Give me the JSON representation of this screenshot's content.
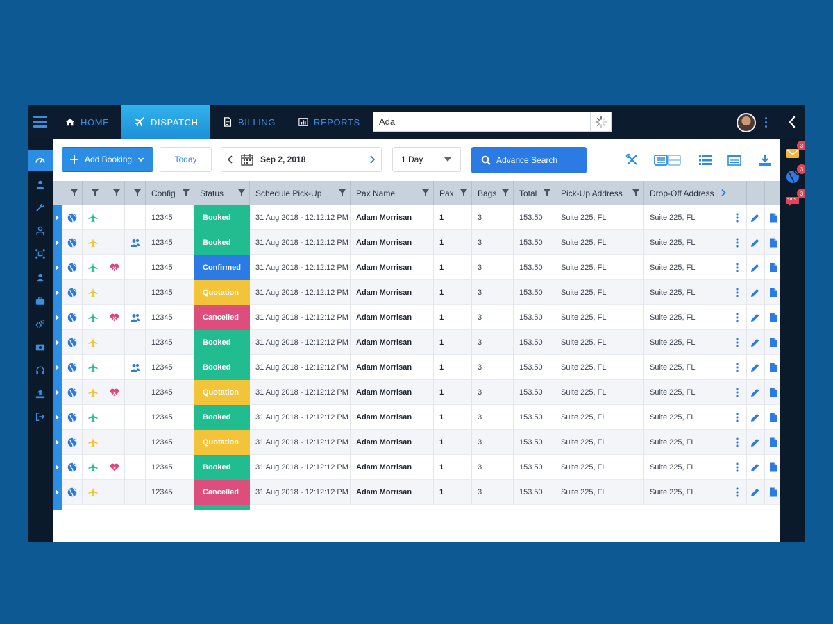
{
  "nav": {
    "tabs": [
      {
        "label": "HOME",
        "icon": "home-icon"
      },
      {
        "label": "DISPATCH",
        "icon": "plane-icon"
      },
      {
        "label": "BILLING",
        "icon": "document-icon"
      },
      {
        "label": "REPORTS",
        "icon": "bar-chart-icon"
      }
    ],
    "search_value": "Ada"
  },
  "toolbar": {
    "add_booking": "Add Booking",
    "today": "Today",
    "date": "Sep 2, 2018",
    "range": "1 Day",
    "advance_search": "Advance Search"
  },
  "notifications": {
    "mail_count": "3",
    "globe_count": "3",
    "sms_count": "3",
    "sms_label": "sms"
  },
  "table": {
    "columns": [
      "Config",
      "Status",
      "Schedule Pick-Up",
      "Pax Name",
      "Pax",
      "Bags",
      "Total",
      "Pick-Up Address",
      "Drop-Off Address"
    ],
    "rows": [
      {
        "config": "12345",
        "status": "Booked",
        "pickup": "31 Aug 2018 - 12:12:12 PM",
        "name": "Adam Morrisan",
        "pax": "1",
        "bags": "3",
        "total": "153.50",
        "from": "Suite 225, FL",
        "to": "Suite 225, FL",
        "plane": "green",
        "heart": false,
        "people": false
      },
      {
        "config": "12345",
        "status": "Booked",
        "pickup": "31 Aug 2018 - 12:12:12 PM",
        "name": "Adam Morrisan",
        "pax": "1",
        "bags": "3",
        "total": "153.50",
        "from": "Suite 225, FL",
        "to": "Suite 225, FL",
        "plane": "yellow",
        "heart": false,
        "people": true
      },
      {
        "config": "12345",
        "status": "Confirmed",
        "pickup": "31 Aug 2018 - 12:12:12 PM",
        "name": "Adam Morrisan",
        "pax": "1",
        "bags": "3",
        "total": "153.50",
        "from": "Suite 225, FL",
        "to": "Suite 225, FL",
        "plane": "green",
        "heart": true,
        "people": false
      },
      {
        "config": "12345",
        "status": "Quotation",
        "pickup": "31 Aug 2018 - 12:12:12 PM",
        "name": "Adam Morrisan",
        "pax": "1",
        "bags": "3",
        "total": "153.50",
        "from": "Suite 225, FL",
        "to": "Suite 225, FL",
        "plane": "yellow",
        "heart": false,
        "people": false
      },
      {
        "config": "12345",
        "status": "Cancelled",
        "pickup": "31 Aug 2018 - 12:12:12 PM",
        "name": "Adam Morrisan",
        "pax": "1",
        "bags": "3",
        "total": "153.50",
        "from": "Suite 225, FL",
        "to": "Suite 225, FL",
        "plane": "green",
        "heart": true,
        "people": true
      },
      {
        "config": "12345",
        "status": "Booked",
        "pickup": "31 Aug 2018 - 12:12:12 PM",
        "name": "Adam Morrisan",
        "pax": "1",
        "bags": "3",
        "total": "153.50",
        "from": "Suite 225, FL",
        "to": "Suite 225, FL",
        "plane": "yellow",
        "heart": false,
        "people": false
      },
      {
        "config": "12345",
        "status": "Booked",
        "pickup": "31 Aug 2018 - 12:12:12 PM",
        "name": "Adam Morrisan",
        "pax": "1",
        "bags": "3",
        "total": "153.50",
        "from": "Suite 225, FL",
        "to": "Suite 225, FL",
        "plane": "green",
        "heart": false,
        "people": true
      },
      {
        "config": "12345",
        "status": "Quotation",
        "pickup": "31 Aug 2018 - 12:12:12 PM",
        "name": "Adam Morrisan",
        "pax": "1",
        "bags": "3",
        "total": "153.50",
        "from": "Suite 225, FL",
        "to": "Suite 225, FL",
        "plane": "yellow",
        "heart": true,
        "people": false
      },
      {
        "config": "12345",
        "status": "Booked",
        "pickup": "31 Aug 2018 - 12:12:12 PM",
        "name": "Adam Morrisan",
        "pax": "1",
        "bags": "3",
        "total": "153.50",
        "from": "Suite 225, FL",
        "to": "Suite 225, FL",
        "plane": "green",
        "heart": false,
        "people": false
      },
      {
        "config": "12345",
        "status": "Quotation",
        "pickup": "31 Aug 2018 - 12:12:12 PM",
        "name": "Adam Morrisan",
        "pax": "1",
        "bags": "3",
        "total": "153.50",
        "from": "Suite 225, FL",
        "to": "Suite 225, FL",
        "plane": "yellow",
        "heart": false,
        "people": false
      },
      {
        "config": "12345",
        "status": "Booked",
        "pickup": "31 Aug 2018 - 12:12:12 PM",
        "name": "Adam Morrisan",
        "pax": "1",
        "bags": "3",
        "total": "153.50",
        "from": "Suite 225, FL",
        "to": "Suite 225, FL",
        "plane": "green",
        "heart": true,
        "people": false
      },
      {
        "config": "12345",
        "status": "Cancelled",
        "pickup": "31 Aug 2018 - 12:12:12 PM",
        "name": "Adam Morrisan",
        "pax": "1",
        "bags": "3",
        "total": "153.50",
        "from": "Suite 225, FL",
        "to": "Suite 225, FL",
        "plane": "yellow",
        "heart": false,
        "people": false
      }
    ]
  },
  "status_colors": {
    "Booked": "#22bc91",
    "Confirmed": "#2c7be5",
    "Quotation": "#f3c43a",
    "Cancelled": "#dd4e7d"
  },
  "colors": {
    "accent": "#2c8de4",
    "plane_green": "#1fbf8f",
    "plane_yellow": "#f1c232",
    "heart": "#e2447a",
    "globe": "#2c7be5"
  }
}
